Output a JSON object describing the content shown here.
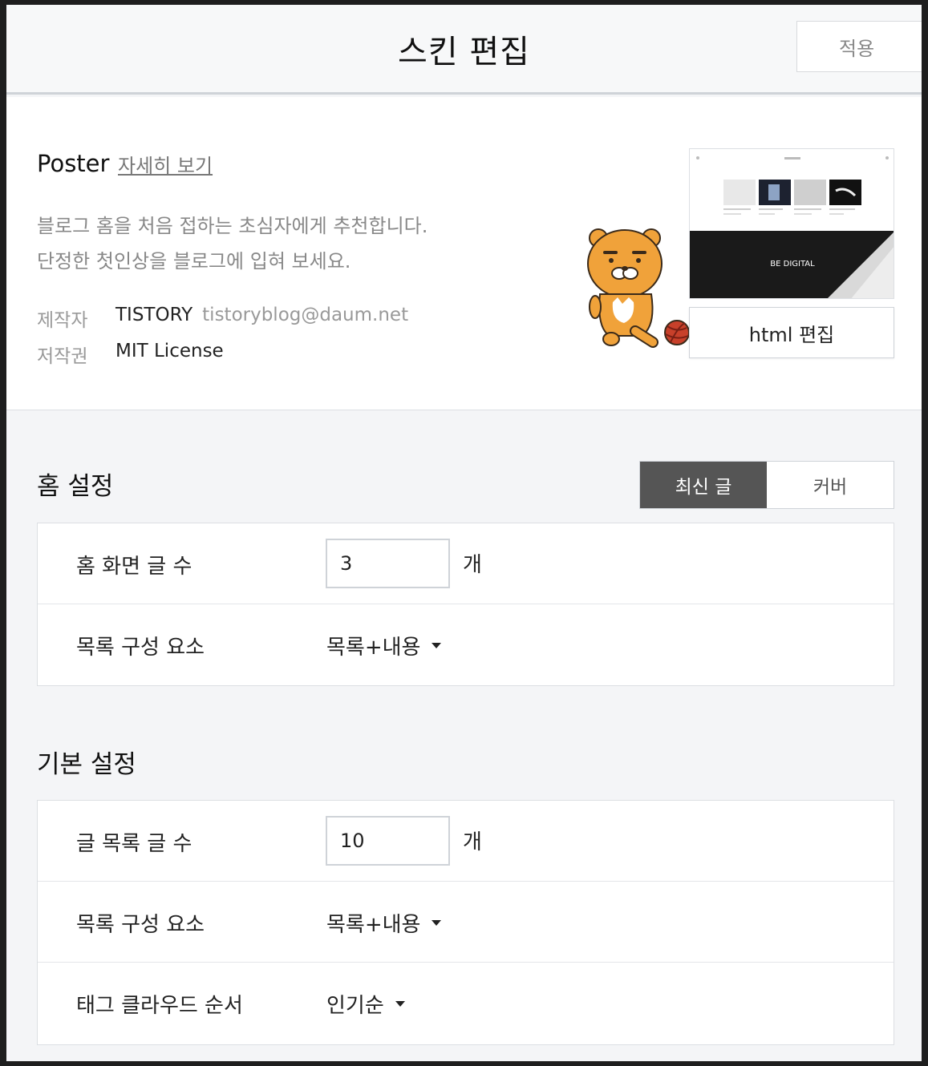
{
  "header": {
    "title": "스킨 편집",
    "apply_label": "적용"
  },
  "skin": {
    "name": "Poster",
    "detail_link": "자세히 보기",
    "description_line1": "블로그 홈을 처음 접하는 초심자에게 추천합니다.",
    "description_line2": "단정한 첫인상을 블로그에 입혀 보세요.",
    "author_label": "제작자",
    "author_name": "TISTORY",
    "author_email": "tistoryblog@daum.net",
    "license_label": "저작권",
    "license_value": "MIT License",
    "thumbnail_caption": "BE DIGITAL",
    "html_edit_label": "html 편집"
  },
  "home_settings": {
    "title": "홈 설정",
    "toggle": [
      {
        "label": "최신 글",
        "active": true
      },
      {
        "label": "커버",
        "active": false
      }
    ],
    "post_count_label": "홈 화면 글 수",
    "post_count_value": "3",
    "unit": "개",
    "list_component_label": "목록 구성 요소",
    "list_component_value": "목록+내용"
  },
  "basic_settings": {
    "title": "기본 설정",
    "post_count_label": "글 목록 글 수",
    "post_count_value": "10",
    "unit": "개",
    "list_component_label": "목록 구성 요소",
    "list_component_value": "목록+내용",
    "tag_cloud_label": "태그 클라우드 순서",
    "tag_cloud_value": "인기순"
  },
  "colors": {
    "toggle_active": "#555555",
    "character_body": "#f0a23a",
    "page_bg": "#f4f5f7"
  }
}
